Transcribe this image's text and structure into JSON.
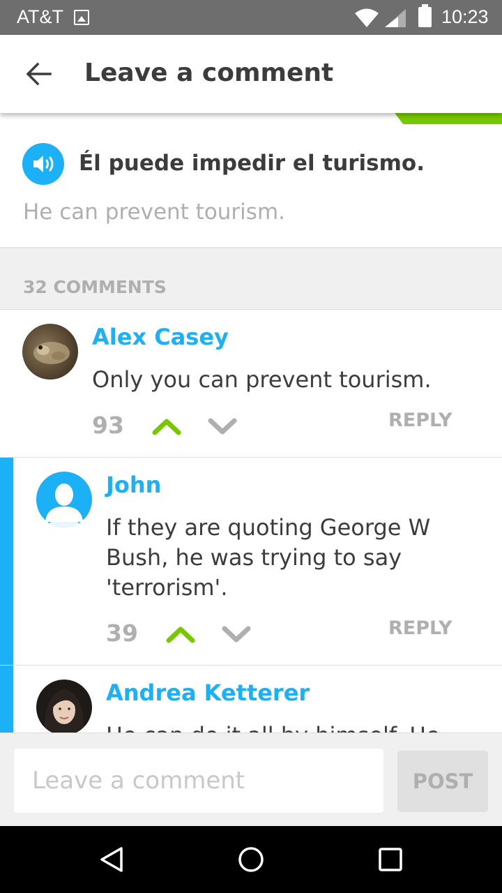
{
  "status_bar": {
    "carrier": "AT&T",
    "time": "10:23"
  },
  "app_bar": {
    "title": "Leave a comment",
    "back_icon": "arrow-left-icon"
  },
  "sentence": {
    "text": "Él puede impedir el turismo.",
    "translation": "He can prevent tourism.",
    "audio_icon": "speaker-icon"
  },
  "comments_header": {
    "count_label": "32 COMMENTS"
  },
  "comments": [
    {
      "author": "Alex Casey",
      "text": "Only you can prevent tourism.",
      "votes": "93",
      "reply_label": "REPLY"
    },
    {
      "author": "John",
      "text": "If they are quoting George W Bush, he was trying to say 'terrorism'.",
      "votes": "39",
      "reply_label": "REPLY"
    },
    {
      "author": "Andrea Ketterer",
      "text": "He can do it all by himself. He"
    }
  ],
  "composer": {
    "placeholder": "Leave a comment",
    "post_label": "POST"
  },
  "colors": {
    "accent_blue": "#1cb0f6",
    "accent_green": "#78c800",
    "muted_gray": "#afafaf"
  }
}
